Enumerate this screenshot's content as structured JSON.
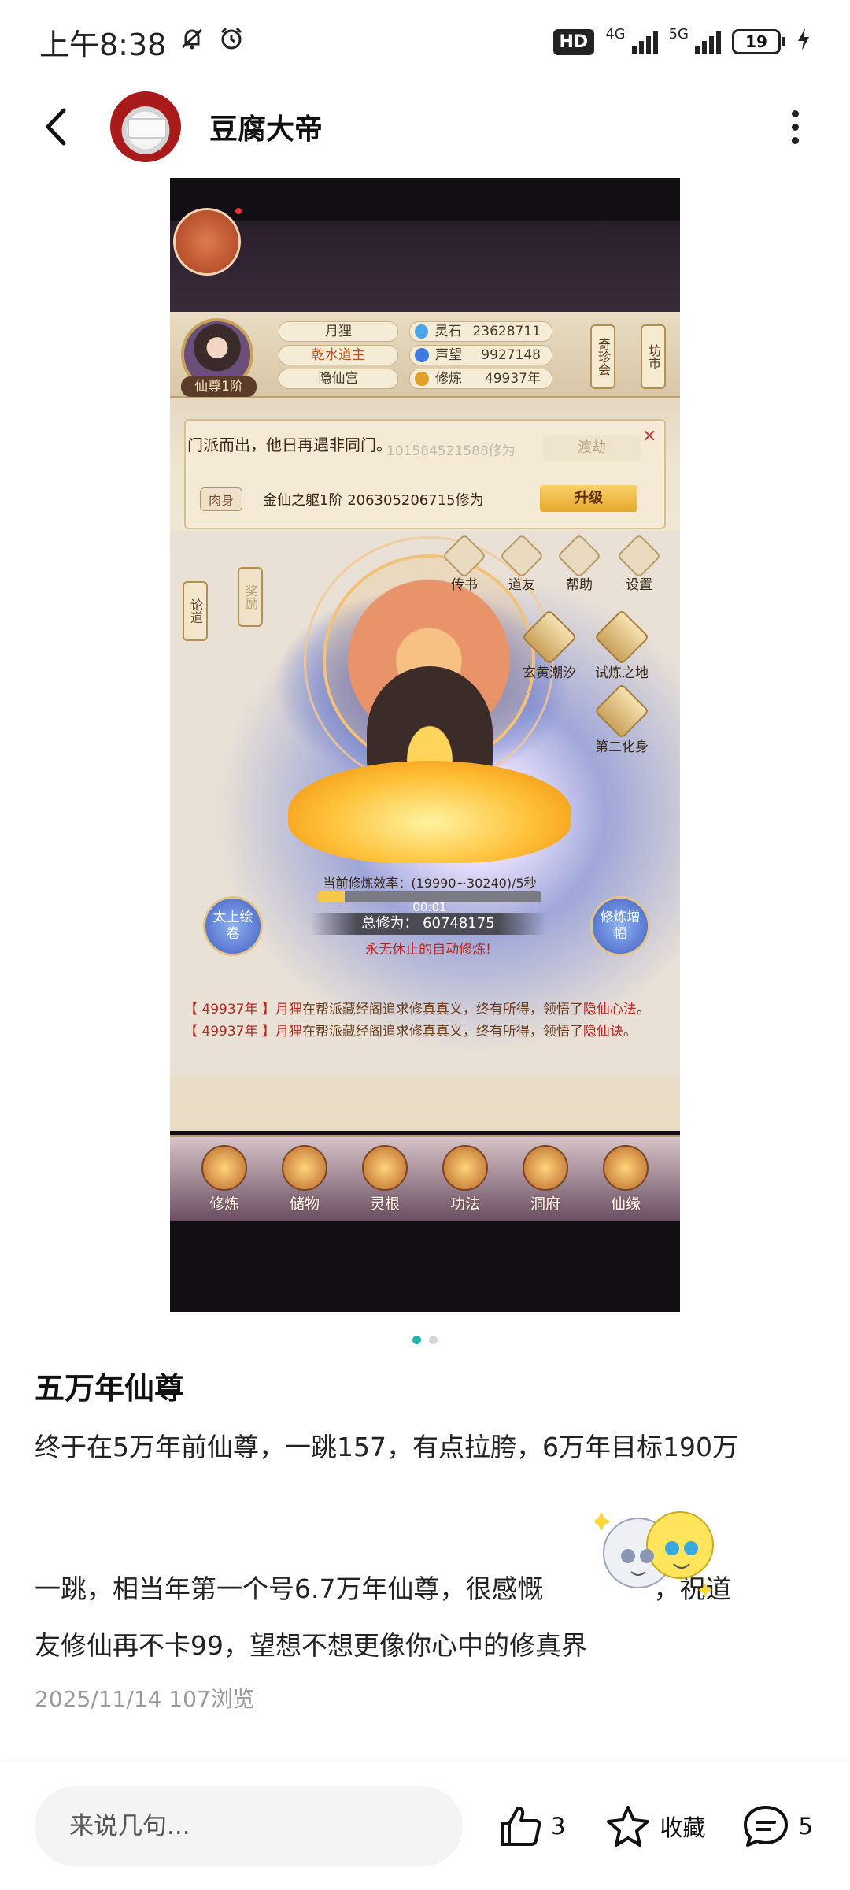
{
  "status_bar": {
    "time": "上午8:38",
    "hd_label": "HD",
    "net1": "4G",
    "net2": "5G",
    "battery": "19",
    "battery_level": 0.19
  },
  "header": {
    "author_name": "豆腐大帝"
  },
  "game": {
    "rank": "仙尊1阶",
    "name": "月狸",
    "title": "乾水道主",
    "sect": "隐仙宫",
    "stats": [
      {
        "label": "灵石",
        "value": "23628711",
        "color": "#4aa6e8"
      },
      {
        "label": "声望",
        "value": "9927148",
        "color": "#3f7be0"
      },
      {
        "label": "修炼",
        "value": "49937年",
        "color": "#e0a02a"
      }
    ],
    "side_tags": [
      "奇珍会",
      "坊市"
    ],
    "left_tags": [
      "论道",
      "奖励"
    ],
    "marquee": "门派而出，他日再遇非同门。",
    "ghost_text": "101584521588修为",
    "cross_button": "渡劫",
    "body_tag": "肉身",
    "body_info": "金仙之躯1阶  206305206715修为",
    "upgrade_button": "升级",
    "menu_icons": [
      "传书",
      "道友",
      "帮助",
      "设置"
    ],
    "diamonds": [
      "玄黄潮汐",
      "试炼之地",
      "第二化身"
    ],
    "orb_left": "太上绘卷",
    "orb_right": "修炼增幅",
    "rate_text": "当前修炼效率：(19990~30240)/5秒",
    "progress": 0.12,
    "timer": "00:01",
    "total_text": "总修为：  60748175",
    "auto_text": "永无休止的自动修炼!",
    "logs": [
      {
        "year": "【 49937年 】",
        "name": "月狸",
        "text": "在帮派藏经阁追求修真真义，终有所得，领悟了",
        "skill": "隐仙心法",
        "end": "。"
      },
      {
        "year": "【 49937年 】",
        "name": "月狸",
        "text": "在帮派藏经阁追求修真真义，终有所得，领悟了",
        "skill": "隐仙诀",
        "end": "。"
      }
    ],
    "bottom_tabs": [
      "修炼",
      "储物",
      "灵根",
      "功法",
      "洞府",
      "仙缘"
    ]
  },
  "post": {
    "title": "五万年仙尊",
    "line1": "终于在5万年前仙尊，一跳157，有点拉胯，6万年目标190万",
    "line2_a": "一跳，相当年第一个号6.7万年仙尊，很感慨",
    "line2_b": "，祝道",
    "line3": "友修仙再不卡99，望想不想更像你心中的修真界",
    "meta": "2025/11/14  107浏览"
  },
  "bottom_bar": {
    "comment_placeholder": "来说几句...",
    "like_count": "3",
    "favorite_label": "收藏",
    "comment_count": "5"
  }
}
